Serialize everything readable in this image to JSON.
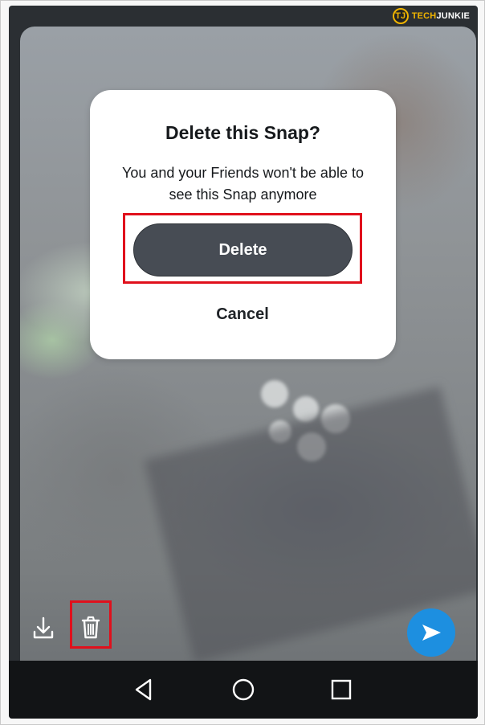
{
  "dialog": {
    "title": "Delete this Snap?",
    "message": "You and your Friends won't be able to see this Snap anymore",
    "delete_label": "Delete",
    "cancel_label": "Cancel"
  },
  "watermark": {
    "logo_letter": "TJ",
    "brand_part1": "TECH",
    "brand_part2": "JUNKIE"
  },
  "toolbar": {
    "icons": [
      "download-icon",
      "trash-icon",
      "send-icon"
    ]
  },
  "navigation": {
    "icons": [
      "back-icon",
      "home-icon",
      "recents-icon"
    ]
  },
  "colors": {
    "highlight": "#e0101c",
    "delete_button": "#474c54",
    "send_button": "#1d8fe0",
    "brand_yellow": "#f0b400"
  }
}
